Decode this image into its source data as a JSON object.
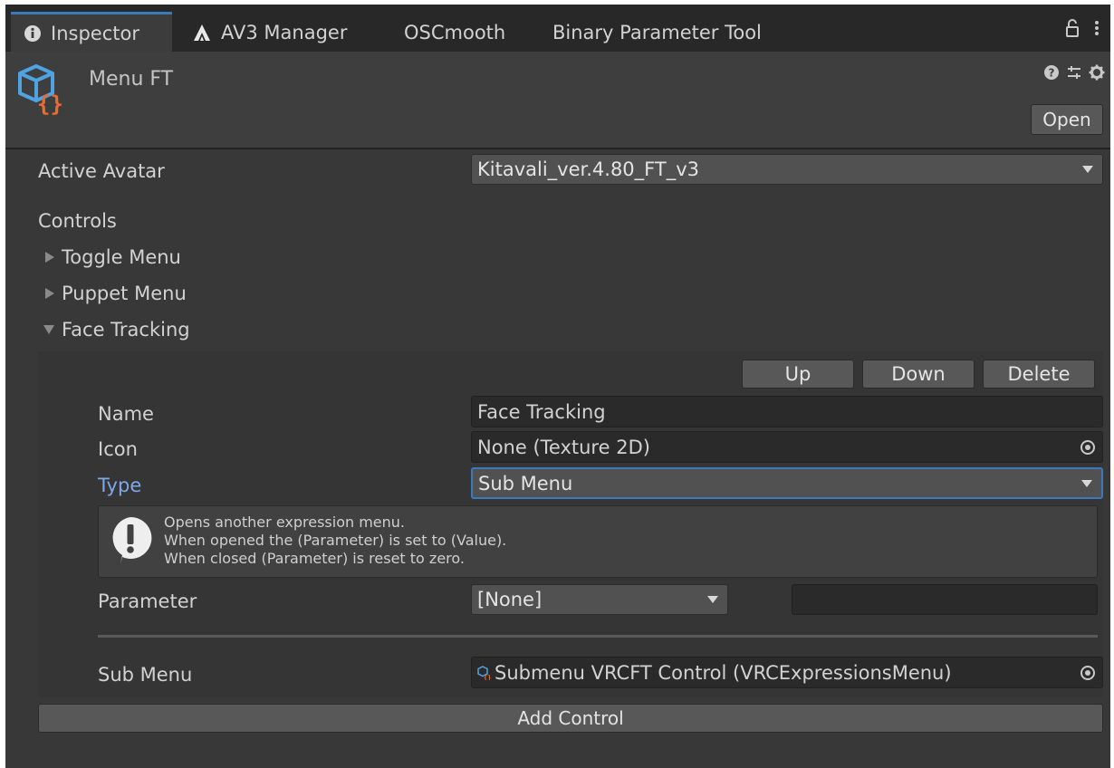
{
  "tabs": [
    {
      "label": "Inspector",
      "icon": "info-icon",
      "active": true
    },
    {
      "label": "AV3 Manager",
      "icon": "av3-logo-icon",
      "active": false
    },
    {
      "label": "OSCmooth",
      "active": false
    },
    {
      "label": "Binary Parameter Tool",
      "active": false
    }
  ],
  "header": {
    "title": "Menu FT",
    "open_label": "Open"
  },
  "active_avatar": {
    "label": "Active Avatar",
    "value": "Kitavali_ver.4.80_FT_v3"
  },
  "controls": {
    "label": "Controls",
    "items": [
      {
        "label": "Toggle Menu",
        "expanded": false
      },
      {
        "label": "Puppet Menu",
        "expanded": false
      },
      {
        "label": "Face Tracking",
        "expanded": true
      }
    ]
  },
  "control_editor": {
    "up_label": "Up",
    "down_label": "Down",
    "delete_label": "Delete",
    "name_label": "Name",
    "name_value": "Face Tracking",
    "icon_label": "Icon",
    "icon_value": "None (Texture 2D)",
    "type_label": "Type",
    "type_value": "Sub Menu",
    "help": [
      "Opens another expression menu.",
      "When opened the (Parameter) is set to (Value).",
      "When closed (Parameter) is reset to zero."
    ],
    "parameter_label": "Parameter",
    "parameter_value": "[None]",
    "parameter_value_field": "",
    "submenu_label": "Sub Menu",
    "submenu_value": "Submenu VRCFT Control (VRCExpressionsMenu)"
  },
  "add_control_label": "Add Control",
  "colors": {
    "background": "#383838",
    "tabbar": "#282828",
    "accent": "#3a79bb",
    "type_label": "#7fa8e8",
    "icon_orange": "#f06a2e",
    "icon_blue": "#4fa3e0"
  }
}
